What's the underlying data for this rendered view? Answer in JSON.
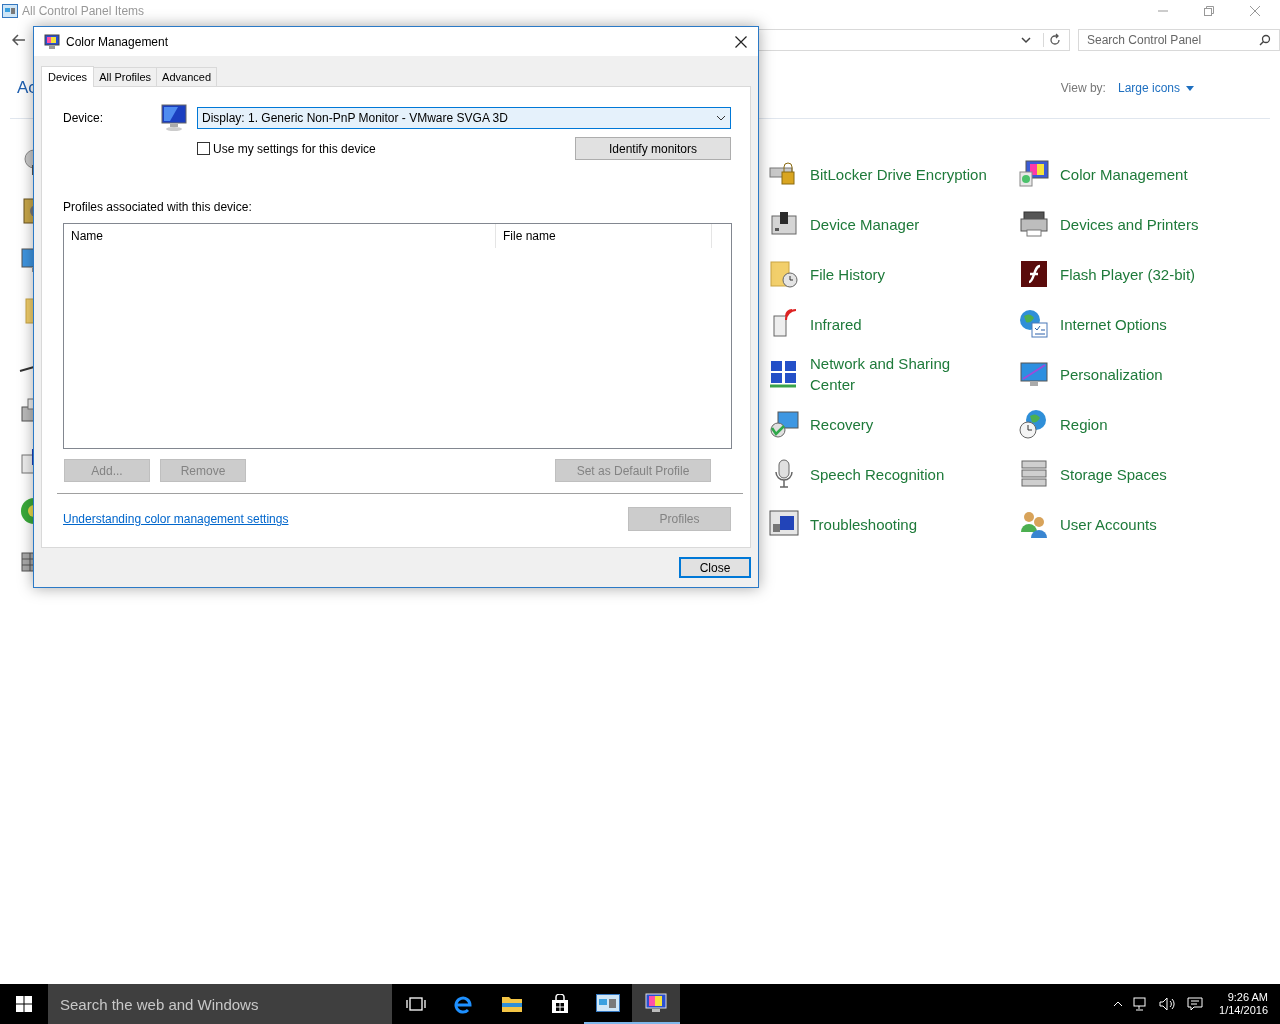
{
  "control_panel": {
    "title": "All Control Panel Items",
    "search": {
      "placeholder": "Search Control Panel"
    },
    "heading": "Ac",
    "view_by": {
      "label": "View by:",
      "value": "Large icons"
    },
    "items": [
      {
        "label": "BitLocker Drive Encryption"
      },
      {
        "label": "Color Management"
      },
      {
        "label": "Device Manager"
      },
      {
        "label": "Devices and Printers"
      },
      {
        "label": "File History"
      },
      {
        "label": "Flash Player (32-bit)"
      },
      {
        "label": "Infrared"
      },
      {
        "label": "Internet Options"
      },
      {
        "label": "Network and Sharing Center"
      },
      {
        "label": "Personalization"
      },
      {
        "label": "Recovery"
      },
      {
        "label": "Region"
      },
      {
        "label": "Speech Recognition"
      },
      {
        "label": "Storage Spaces"
      },
      {
        "label": "Troubleshooting"
      },
      {
        "label": "User Accounts"
      }
    ]
  },
  "dialog": {
    "title": "Color Management",
    "tabs": [
      {
        "label": "Devices",
        "selected": true
      },
      {
        "label": "All Profiles",
        "selected": false
      },
      {
        "label": "Advanced",
        "selected": false
      }
    ],
    "device_label": "Device:",
    "device_value": "Display: 1. Generic Non-PnP Monitor - VMware SVGA 3D",
    "use_my_settings": {
      "label": "Use my settings for this device",
      "checked": false
    },
    "identify_button": "Identify monitors",
    "profiles_label": "Profiles associated with this device:",
    "columns": [
      "Name",
      "File name"
    ],
    "profile_buttons": [
      {
        "label": "Add...",
        "disabled": true
      },
      {
        "label": "Remove",
        "disabled": true
      },
      {
        "label": "Set as Default Profile",
        "disabled": true
      }
    ],
    "link": "Understanding color management settings",
    "profiles_button": {
      "label": "Profiles",
      "disabled": true
    },
    "close_button": "Close"
  },
  "taskbar": {
    "search": {
      "placeholder": "Search the web and Windows"
    },
    "apps": [
      {
        "kind": "task-view",
        "running": false,
        "selected": false
      },
      {
        "kind": "browser",
        "running": false,
        "selected": false
      },
      {
        "kind": "folder",
        "running": false,
        "selected": false
      },
      {
        "kind": "store",
        "running": false,
        "selected": false
      },
      {
        "kind": "control-panel",
        "running": true,
        "selected": false
      },
      {
        "kind": "monitor",
        "running": true,
        "selected": true
      }
    ],
    "time": "9:26 AM",
    "date": "1/14/2016"
  }
}
